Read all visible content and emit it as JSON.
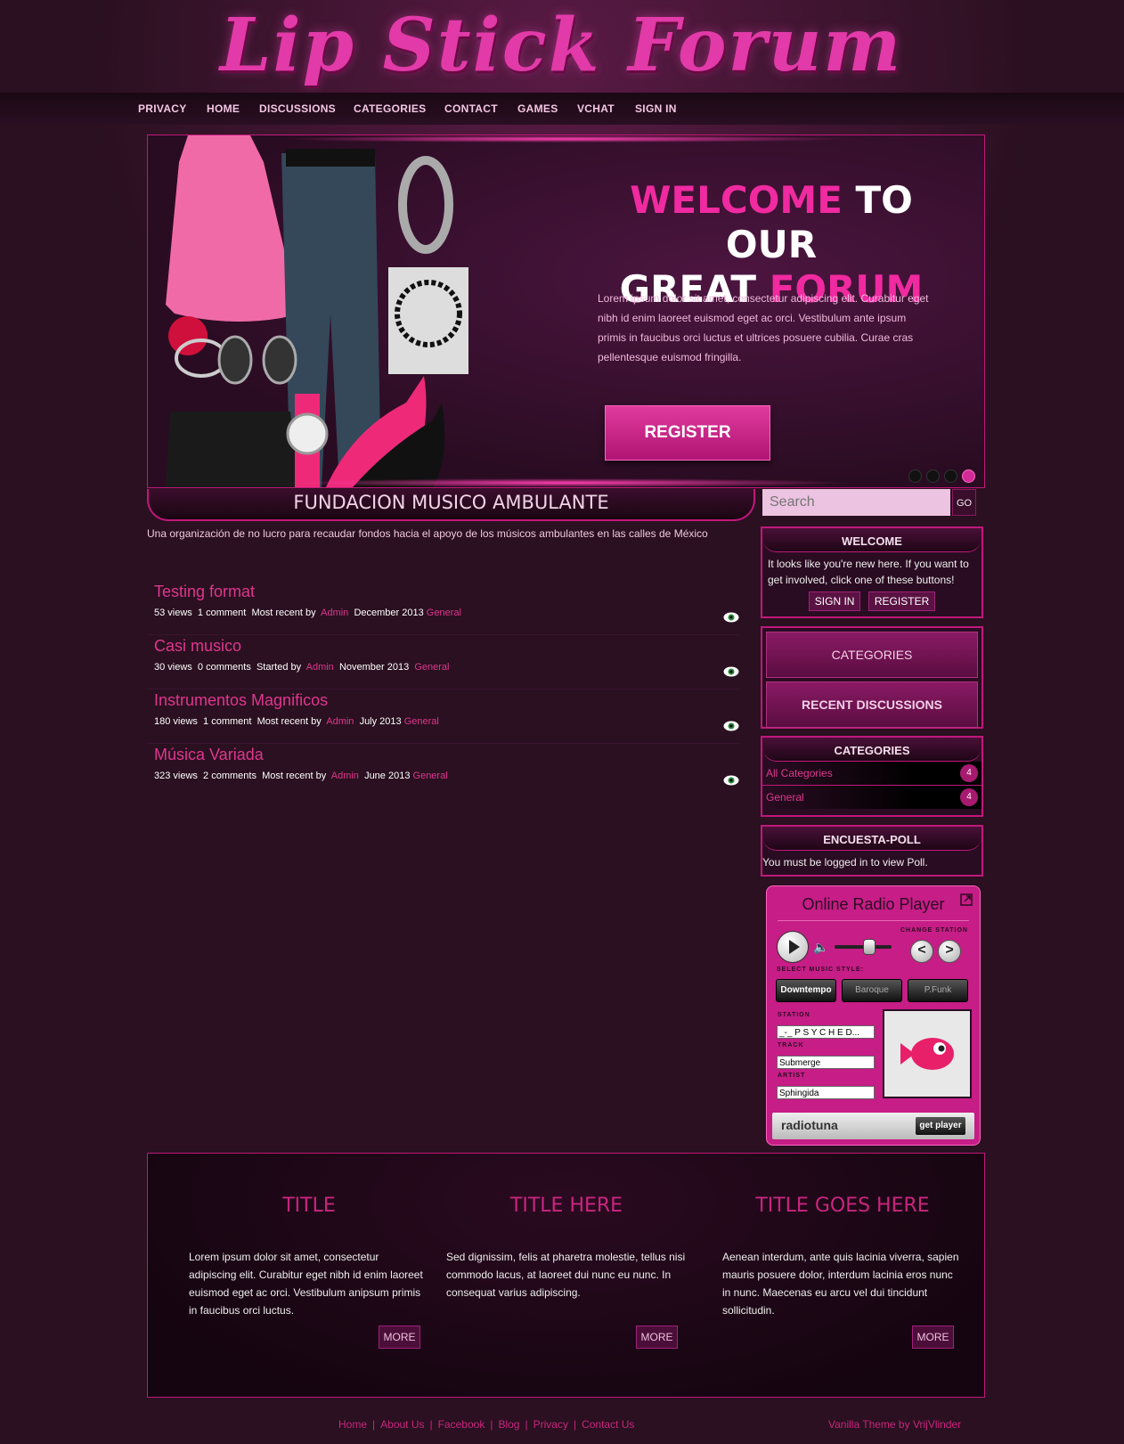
{
  "logo": "Lip Stick Forum",
  "nav": [
    "PRIVACY",
    "HOME",
    "DISCUSSIONS",
    "CATEGORIES",
    "CONTACT",
    "GAMES",
    "VCHAT",
    "SIGN IN"
  ],
  "hero": {
    "title_a": "WELCOME",
    "title_b": " TO OUR",
    "title_c": "GREAT ",
    "title_d": "FORUM",
    "text": "Lorem ipsum dolor sit amet, consectetur adipiscing elit. Curabitur eget nibh id enim laoreet euismod eget ac orci. Vestibulum ante ipsum primis in faucibus orci luctus et ultrices posuere cubilia. Curae cras pellentesque euismod fringilla.",
    "register": "REGISTER",
    "slides": 4,
    "active_slide": 4
  },
  "section": {
    "title": "FUNDACION MUSICO AMBULANTE",
    "subtitle": "Una organización de no lucro para recaudar fondos hacia el apoyo de los músicos ambulantes en las calles de México"
  },
  "discussions": [
    {
      "title": "Testing format",
      "views": "53 views",
      "comments": "1 comment",
      "by": "Most recent by",
      "user": "Admin",
      "date": "December 2013",
      "category": "General"
    },
    {
      "title": "Casi musico",
      "views": "30 views",
      "comments": "0 comments",
      "by": "Started by",
      "user": "Admin",
      "date": "November 2013",
      "category": "General"
    },
    {
      "title": "Instrumentos Magnificos",
      "views": "180 views",
      "comments": "1 comment",
      "by": "Most recent by",
      "user": "Admin",
      "date": "July 2013",
      "category": "General"
    },
    {
      "title": "Música Variada",
      "views": "323 views",
      "comments": "2 comments",
      "by": "Most recent by",
      "user": "Admin",
      "date": "June 2013",
      "category": "General"
    }
  ],
  "search": {
    "placeholder": "Search",
    "go": "GO"
  },
  "welcome_panel": {
    "title": "WELCOME",
    "text": "It looks like you're new here. If you want to get involved, click one of these buttons!",
    "sign_in": "SIGN IN",
    "register": "REGISTER"
  },
  "nav_panel": {
    "categories": "CATEGORIES",
    "recent": "RECENT DISCUSSIONS"
  },
  "categories_panel": {
    "title": "CATEGORIES",
    "items": [
      {
        "name": "All Categories",
        "count": "4"
      },
      {
        "name": "General",
        "count": "4"
      }
    ]
  },
  "poll_panel": {
    "title": "ENCUESTA-POLL",
    "text": "You must be logged in to view Poll."
  },
  "radio": {
    "title": "Online Radio Player",
    "change_station": "CHANGE STATION",
    "select_style": "SELECT MUSIC STYLE:",
    "styles": [
      "Downtempo",
      "Baroque",
      "P.Funk"
    ],
    "station_label": "STATION",
    "station": "_-_ P S Y C H E D...",
    "track_label": "TRACK",
    "track": "Submerge",
    "artist_label": "ARTIST",
    "artist": "Sphingida",
    "brand": "radiotuna",
    "get_player": "get player"
  },
  "footer_cols": [
    {
      "title": "TITLE",
      "text": "Lorem ipsum dolor sit amet, consectetur adipiscing elit. Curabitur eget nibh id enim laoreet euismod eget ac orci. Vestibulum anipsum primis in faucibus orci luctus.",
      "more": "MORE"
    },
    {
      "title": "TITLE HERE",
      "text": "Sed dignissim, felis at pharetra molestie, tellus nisi commodo lacus, at laoreet dui nunc eu nunc. In consequat varius adipiscing.",
      "more": "MORE"
    },
    {
      "title": "TITLE GOES HERE",
      "text": "Aenean interdum, ante quis lacinia viverra, sapien mauris posuere dolor, interdum lacinia eros nunc in nunc. Maecenas eu arcu vel dui tincidunt sollicitudin.",
      "more": "MORE"
    }
  ],
  "bottom_links": [
    "Home",
    "About Us",
    "Facebook",
    "Blog",
    "Privacy",
    "Contact Us"
  ],
  "credit": "Vanilla Theme by VrijVlinder",
  "colors": {
    "accent": "#e0368f",
    "background": "#2a1020",
    "border": "#c0187a"
  }
}
